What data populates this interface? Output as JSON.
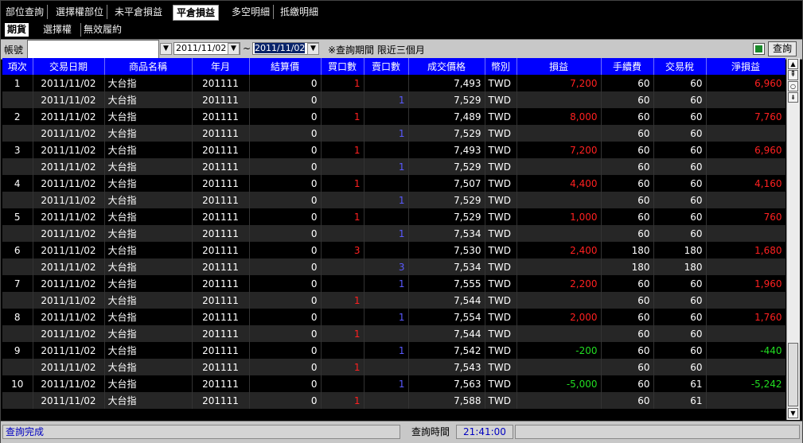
{
  "tabs": [
    "部位查詢",
    "選擇權部位",
    "未平倉損益",
    "平倉損益",
    "多空明細",
    "抵繳明細"
  ],
  "active_tab": 3,
  "subtabs": [
    "期貨",
    "選擇權",
    "無效履約"
  ],
  "active_subtab": 0,
  "query": {
    "account_label": "帳號",
    "account_value": "",
    "date_from": "2011/11/02",
    "tilde": "~",
    "date_to": "2011/11/02",
    "note": "※查詢期間 限近三個月",
    "query_button": "查詢",
    "export_icon": "excel-icon"
  },
  "columns": [
    "項次",
    "交易日期",
    "商品名稱",
    "年月",
    "結算價",
    "買口數",
    "賣口數",
    "成交價格",
    "幣別",
    "損益",
    "手續費",
    "交易稅",
    "淨損益"
  ],
  "rows": [
    {
      "no": "1",
      "date": "2011/11/02",
      "name": "大台指",
      "ym": "201111",
      "settle": "0",
      "buy": "1",
      "sell": "",
      "price": "7,493",
      "cur": "TWD",
      "pl": "7,200",
      "fee": "60",
      "tax": "60",
      "net": "6,960"
    },
    {
      "no": "",
      "date": "2011/11/02",
      "name": "大台指",
      "ym": "201111",
      "settle": "0",
      "buy": "",
      "sell": "1",
      "price": "7,529",
      "cur": "TWD",
      "pl": "",
      "fee": "60",
      "tax": "60",
      "net": ""
    },
    {
      "no": "2",
      "date": "2011/11/02",
      "name": "大台指",
      "ym": "201111",
      "settle": "0",
      "buy": "1",
      "sell": "",
      "price": "7,489",
      "cur": "TWD",
      "pl": "8,000",
      "fee": "60",
      "tax": "60",
      "net": "7,760"
    },
    {
      "no": "",
      "date": "2011/11/02",
      "name": "大台指",
      "ym": "201111",
      "settle": "0",
      "buy": "",
      "sell": "1",
      "price": "7,529",
      "cur": "TWD",
      "pl": "",
      "fee": "60",
      "tax": "60",
      "net": ""
    },
    {
      "no": "3",
      "date": "2011/11/02",
      "name": "大台指",
      "ym": "201111",
      "settle": "0",
      "buy": "1",
      "sell": "",
      "price": "7,493",
      "cur": "TWD",
      "pl": "7,200",
      "fee": "60",
      "tax": "60",
      "net": "6,960"
    },
    {
      "no": "",
      "date": "2011/11/02",
      "name": "大台指",
      "ym": "201111",
      "settle": "0",
      "buy": "",
      "sell": "1",
      "price": "7,529",
      "cur": "TWD",
      "pl": "",
      "fee": "60",
      "tax": "60",
      "net": ""
    },
    {
      "no": "4",
      "date": "2011/11/02",
      "name": "大台指",
      "ym": "201111",
      "settle": "0",
      "buy": "1",
      "sell": "",
      "price": "7,507",
      "cur": "TWD",
      "pl": "4,400",
      "fee": "60",
      "tax": "60",
      "net": "4,160"
    },
    {
      "no": "",
      "date": "2011/11/02",
      "name": "大台指",
      "ym": "201111",
      "settle": "0",
      "buy": "",
      "sell": "1",
      "price": "7,529",
      "cur": "TWD",
      "pl": "",
      "fee": "60",
      "tax": "60",
      "net": ""
    },
    {
      "no": "5",
      "date": "2011/11/02",
      "name": "大台指",
      "ym": "201111",
      "settle": "0",
      "buy": "1",
      "sell": "",
      "price": "7,529",
      "cur": "TWD",
      "pl": "1,000",
      "fee": "60",
      "tax": "60",
      "net": "760"
    },
    {
      "no": "",
      "date": "2011/11/02",
      "name": "大台指",
      "ym": "201111",
      "settle": "0",
      "buy": "",
      "sell": "1",
      "price": "7,534",
      "cur": "TWD",
      "pl": "",
      "fee": "60",
      "tax": "60",
      "net": ""
    },
    {
      "no": "6",
      "date": "2011/11/02",
      "name": "大台指",
      "ym": "201111",
      "settle": "0",
      "buy": "3",
      "sell": "",
      "price": "7,530",
      "cur": "TWD",
      "pl": "2,400",
      "fee": "180",
      "tax": "180",
      "net": "1,680"
    },
    {
      "no": "",
      "date": "2011/11/02",
      "name": "大台指",
      "ym": "201111",
      "settle": "0",
      "buy": "",
      "sell": "3",
      "price": "7,534",
      "cur": "TWD",
      "pl": "",
      "fee": "180",
      "tax": "180",
      "net": ""
    },
    {
      "no": "7",
      "date": "2011/11/02",
      "name": "大台指",
      "ym": "201111",
      "settle": "0",
      "buy": "",
      "sell": "1",
      "price": "7,555",
      "cur": "TWD",
      "pl": "2,200",
      "fee": "60",
      "tax": "60",
      "net": "1,960"
    },
    {
      "no": "",
      "date": "2011/11/02",
      "name": "大台指",
      "ym": "201111",
      "settle": "0",
      "buy": "1",
      "sell": "",
      "price": "7,544",
      "cur": "TWD",
      "pl": "",
      "fee": "60",
      "tax": "60",
      "net": ""
    },
    {
      "no": "8",
      "date": "2011/11/02",
      "name": "大台指",
      "ym": "201111",
      "settle": "0",
      "buy": "",
      "sell": "1",
      "price": "7,554",
      "cur": "TWD",
      "pl": "2,000",
      "fee": "60",
      "tax": "60",
      "net": "1,760"
    },
    {
      "no": "",
      "date": "2011/11/02",
      "name": "大台指",
      "ym": "201111",
      "settle": "0",
      "buy": "1",
      "sell": "",
      "price": "7,544",
      "cur": "TWD",
      "pl": "",
      "fee": "60",
      "tax": "60",
      "net": ""
    },
    {
      "no": "9",
      "date": "2011/11/02",
      "name": "大台指",
      "ym": "201111",
      "settle": "0",
      "buy": "",
      "sell": "1",
      "price": "7,542",
      "cur": "TWD",
      "pl": "-200",
      "fee": "60",
      "tax": "60",
      "net": "-440"
    },
    {
      "no": "",
      "date": "2011/11/02",
      "name": "大台指",
      "ym": "201111",
      "settle": "0",
      "buy": "1",
      "sell": "",
      "price": "7,543",
      "cur": "TWD",
      "pl": "",
      "fee": "60",
      "tax": "60",
      "net": ""
    },
    {
      "no": "10",
      "date": "2011/11/02",
      "name": "大台指",
      "ym": "201111",
      "settle": "0",
      "buy": "",
      "sell": "1",
      "price": "7,563",
      "cur": "TWD",
      "pl": "-5,000",
      "fee": "60",
      "tax": "61",
      "net": "-5,242"
    },
    {
      "no": "",
      "date": "2011/11/02",
      "name": "大台指",
      "ym": "201111",
      "settle": "0",
      "buy": "1",
      "sell": "",
      "price": "7,588",
      "cur": "TWD",
      "pl": "",
      "fee": "60",
      "tax": "61",
      "net": ""
    }
  ],
  "status": {
    "message": "查詢完成",
    "time_label": "查詢時間",
    "time_value": "21:41:00"
  },
  "colors": {
    "header_bg": "#0000ff",
    "buy": "#ff2020",
    "sell": "#5a5aff",
    "profit": "#ff2020",
    "loss": "#22dd22"
  }
}
